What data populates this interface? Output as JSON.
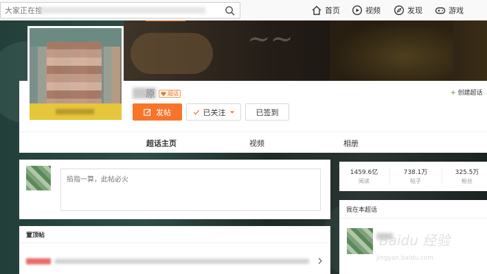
{
  "topbar": {
    "search_placeholder": "大家正在搜",
    "nav": [
      {
        "label": "首页",
        "icon": "home-icon"
      },
      {
        "label": "视频",
        "icon": "video-icon"
      },
      {
        "label": "发现",
        "icon": "discover-icon"
      },
      {
        "label": "游戏",
        "icon": "game-icon"
      }
    ]
  },
  "profile": {
    "name_tail": "原",
    "badge": "超话",
    "create_link": "创建超话"
  },
  "actions": {
    "post": "发帖",
    "follow": "已关注",
    "sign": "已签到"
  },
  "tabs": [
    "超话主页",
    "视频",
    "相册"
  ],
  "composer": {
    "placeholder": "掐指一算，此帖必火"
  },
  "pinned": {
    "title": "置顶帖"
  },
  "stats": [
    {
      "value": "1459.6亿",
      "label": "阅读"
    },
    {
      "value": "738.1万",
      "label": "帖子"
    },
    {
      "value": "325.5万",
      "label": "粉丝"
    }
  ],
  "my_section": {
    "title": "我在本超话"
  },
  "watermark": {
    "brand": "Baidu 经验",
    "url": "jingyan.baidu.com"
  },
  "colors": {
    "accent": "#f7752b",
    "badge_gold": "#e6c63a",
    "create_plus": "#63a53e"
  }
}
